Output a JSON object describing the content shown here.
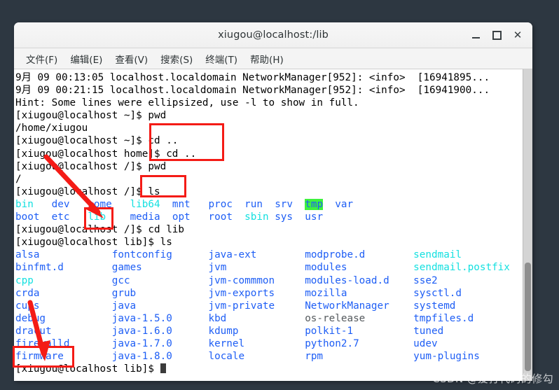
{
  "window": {
    "title": "xiugou@localhost:/lib",
    "buttons": {
      "minimize": "minimize",
      "maximize": "maximize",
      "close": "close"
    }
  },
  "menubar": {
    "items": [
      {
        "label": "文件(F)"
      },
      {
        "label": "编辑(E)"
      },
      {
        "label": "查看(V)"
      },
      {
        "label": "搜索(S)"
      },
      {
        "label": "终端(T)"
      },
      {
        "label": "帮助(H)"
      }
    ]
  },
  "terminal": {
    "log_lines": [
      "9月 09 00:13:05 localhost.localdomain NetworkManager[952]: <info>  [16941895...",
      "9月 09 00:21:15 localhost.localdomain NetworkManager[952]: <info>  [16941900...",
      "Hint: Some lines were ellipsized, use -l to show in full."
    ],
    "prompt_home": "[xiugou@localhost ~]$ ",
    "prompt_home_dir": "[xiugou@localhost home]$ ",
    "prompt_root": "[xiugou@localhost /]$ ",
    "prompt_lib": "[xiugou@localhost lib]$ ",
    "commands": {
      "pwd": "pwd",
      "cd_up": "cd ..",
      "ls": "ls",
      "cd_lib": "cd lib"
    },
    "outputs": {
      "pwd_home": "/home/xiugou",
      "pwd_root": "/"
    },
    "root_listing": [
      [
        {
          "name": "bin",
          "type": "link"
        },
        {
          "name": "dev",
          "type": "dir"
        },
        {
          "name": "home",
          "type": "dir"
        },
        {
          "name": "lib64",
          "type": "link"
        },
        {
          "name": "mnt",
          "type": "dir"
        },
        {
          "name": "proc",
          "type": "dir"
        },
        {
          "name": "run",
          "type": "dir"
        },
        {
          "name": "srv",
          "type": "dir"
        },
        {
          "name": "tmp",
          "type": "sticky"
        },
        {
          "name": "var",
          "type": "dir"
        }
      ],
      [
        {
          "name": "boot",
          "type": "dir"
        },
        {
          "name": "etc",
          "type": "dir"
        },
        {
          "name": "lib",
          "type": "link"
        },
        {
          "name": "media",
          "type": "dir"
        },
        {
          "name": "opt",
          "type": "dir"
        },
        {
          "name": "root",
          "type": "dir"
        },
        {
          "name": "sbin",
          "type": "link"
        },
        {
          "name": "sys",
          "type": "dir"
        },
        {
          "name": "usr",
          "type": "dir"
        }
      ]
    ],
    "lib_listing": {
      "columns": [
        [
          "alsa",
          "binfmt.d",
          "cpp",
          "crda",
          "cups",
          "debug",
          "dracut",
          "firewalld",
          "firmware"
        ],
        [
          "fontconfig",
          "games",
          "gcc",
          "grub",
          "java",
          "java-1.5.0",
          "java-1.6.0",
          "java-1.7.0",
          "java-1.8.0"
        ],
        [
          "java-ext",
          "jvm",
          "jvm-commmon",
          "jvm-exports",
          "jvm-private",
          "kbd",
          "kdump",
          "kernel",
          "locale"
        ],
        [
          "modprobe.d",
          "modules",
          "modules-load.d",
          "mozilla",
          "NetworkManager",
          "os-release",
          "polkit-1",
          "python2.7",
          "rpm"
        ],
        [
          "sendmail",
          "sendmail.postfix",
          "sse2",
          "sysctl.d",
          "systemd",
          "tmpfiles.d",
          "tuned",
          "udev",
          "yum-plugins"
        ]
      ],
      "types": {
        "cpp": "link",
        "sendmail": "link",
        "sendmail.postfix": "link",
        "os-release": "file"
      }
    }
  },
  "annotations": {
    "boxes": [
      {
        "name": "cd-command-highlight",
        "label": "cd .. commands"
      },
      {
        "name": "ls-command-highlight",
        "label": "ls command"
      },
      {
        "name": "lib-directory-highlight",
        "label": "lib"
      },
      {
        "name": "firmware-directory-highlight",
        "label": "firmware"
      }
    ],
    "arrows": [
      {
        "name": "arrow-to-lib",
        "label": "points to lib"
      },
      {
        "name": "arrow-to-firmware",
        "label": "points to firmware"
      }
    ],
    "color": "#f41b16"
  },
  "watermark": {
    "text": "CSDN @爱打代码的修勾"
  },
  "colors": {
    "desktop_background": "#2d3741",
    "terminal_background": "#ffffff",
    "directory_blue": "#1e5ef5",
    "symlink_cyan": "#14e0e0",
    "sticky_green_bg": "#3df23d",
    "annotation_red": "#f41b16"
  }
}
